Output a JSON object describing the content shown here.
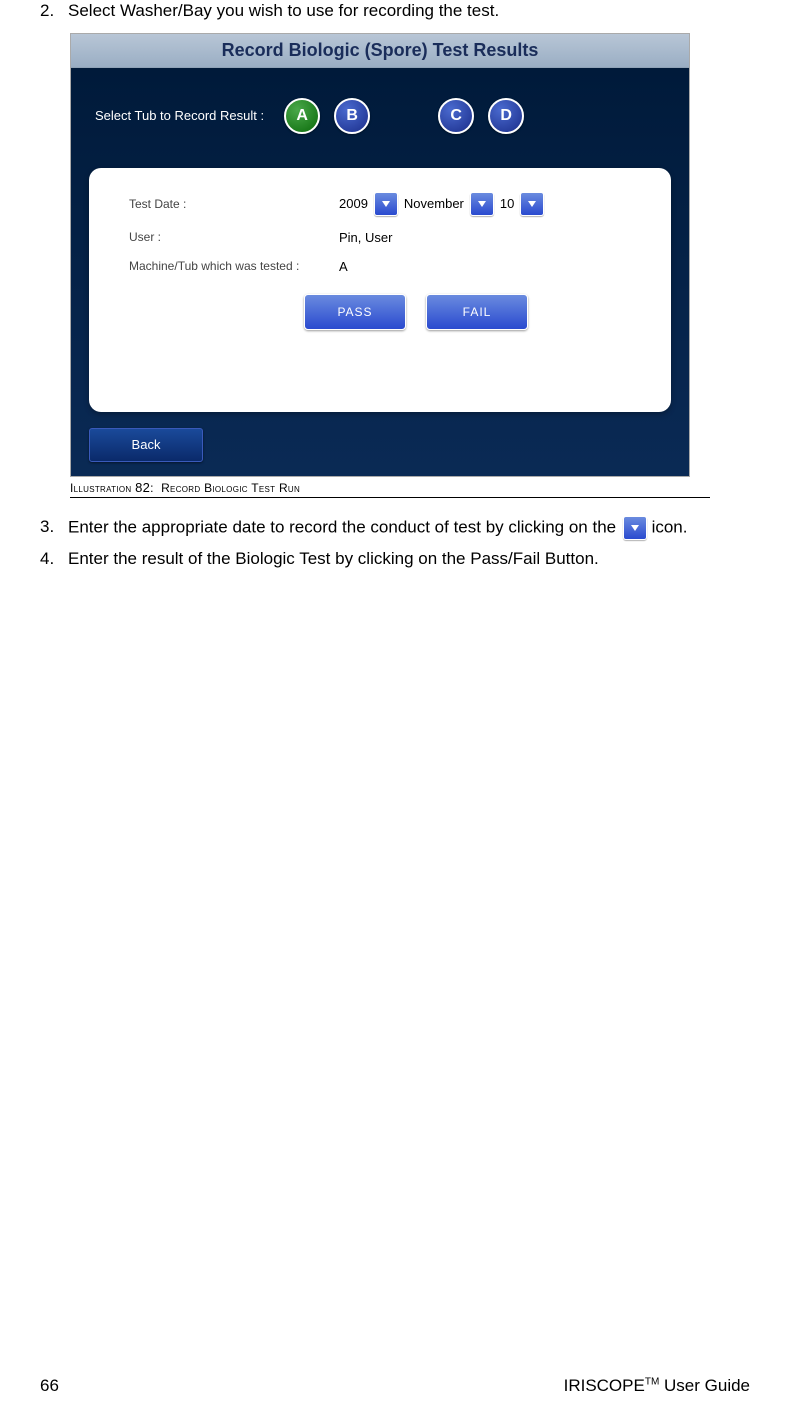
{
  "steps": {
    "s2": {
      "num": "2.",
      "text": "Select Washer/Bay you wish to use for recording the test."
    },
    "s3": {
      "num": "3.",
      "text_before": "Enter the appropriate date to record the conduct of test by clicking on the ",
      "text_after": " icon."
    },
    "s4": {
      "num": "4.",
      "text": "Enter the result of the Biologic Test by clicking on the Pass/Fail Button."
    }
  },
  "screenshot": {
    "title": "Record Biologic (Spore) Test Results",
    "select_label": "Select Tub to Record Result :",
    "tubs": {
      "a": "A",
      "b": "B",
      "c": "C",
      "d": "D"
    },
    "fields": {
      "date_label": "Test Date :",
      "year": "2009",
      "month": "November",
      "day": "10",
      "user_label": "User :",
      "user_value": "Pin, User",
      "machine_label": "Machine/Tub which was tested :",
      "machine_value": "A"
    },
    "pass": "PASS",
    "fail": "FAIL",
    "back": "Back"
  },
  "caption": {
    "prefix": "Illustration",
    "num": "82",
    "colon": ":",
    "title": "Record Biologic Test Run"
  },
  "footer": {
    "page": "66",
    "guide_before": "IRISCOPE",
    "guide_tm": "TM",
    "guide_after": " User Guide"
  }
}
